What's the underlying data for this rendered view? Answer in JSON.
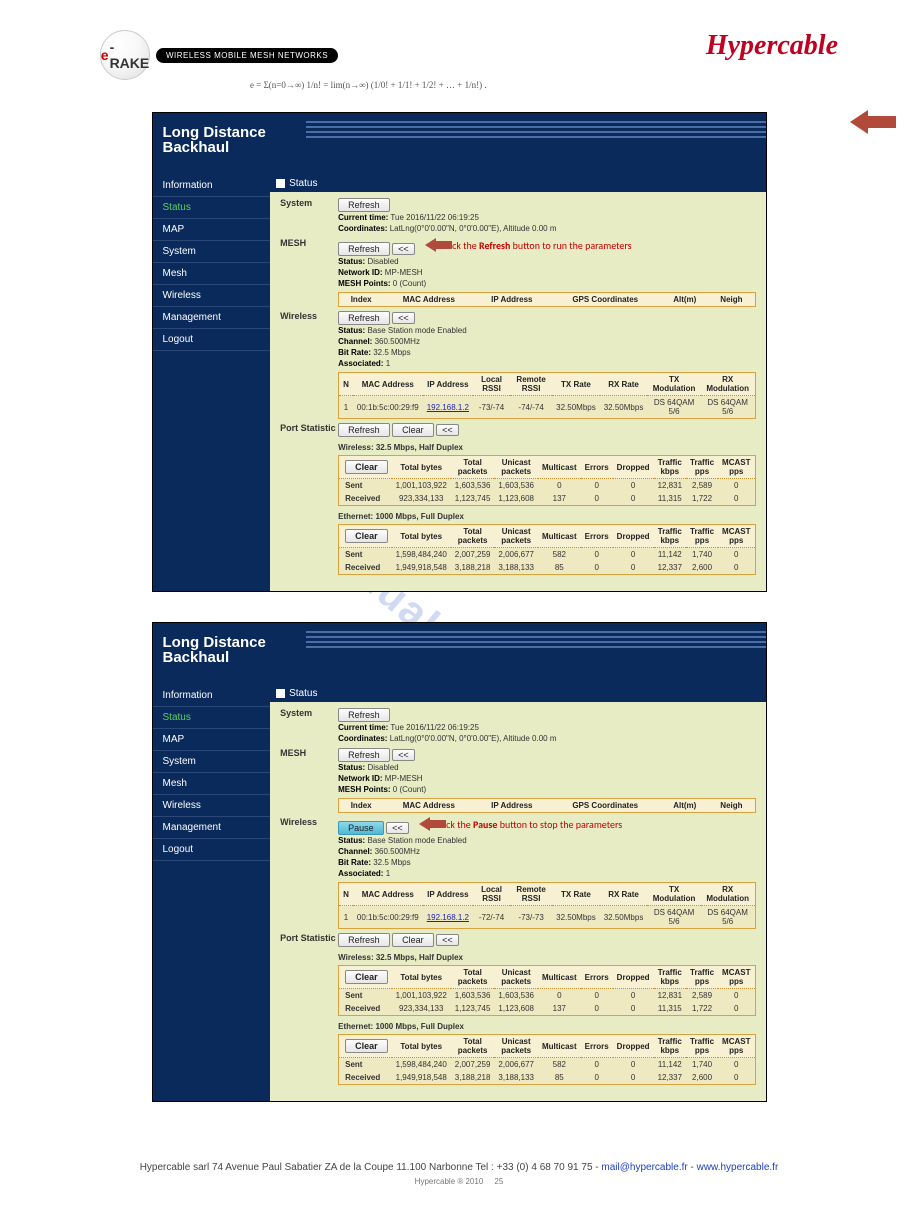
{
  "logos": {
    "erake_e": "e",
    "erake_text": "-RAKE",
    "erake_pill": "WIRELESS MOBILE MESH NETWORKS",
    "formula": "e = Σ(n=0→∞) 1/n! = lim(n→∞) (1/0! + 1/1! + 1/2! + … + 1/n!) .",
    "hypercable": "Hypercable"
  },
  "app_common": {
    "title_l1": "Long Distance",
    "title_l2": "Backhaul",
    "nav": [
      "Information",
      "Status",
      "MAP",
      "System",
      "Mesh",
      "Wireless",
      "Management",
      "Logout"
    ],
    "active_nav": "Status",
    "content_title": "Status",
    "buttons": {
      "refresh": "Refresh",
      "back": "<<",
      "clear": "Clear",
      "pause": "Pause"
    },
    "section_labels": {
      "system": "System",
      "mesh": "MESH",
      "wireless": "Wireless",
      "port": "Port Statistic"
    },
    "system_kv": {
      "current_time_label": "Current time:",
      "current_time": "Tue 2016/11/22 06:19:25",
      "coords_label": "Coordinates:",
      "coords": "LatLng(0°0'0.00\"N, 0°0'0.00\"E), Altitude 0.00 m"
    },
    "mesh_kv": {
      "status_label": "Status:",
      "status": "Disabled",
      "netid_label": "Network ID:",
      "netid": "MP-MESH",
      "points_label": "MESH Points:",
      "points": "0 (Count)"
    },
    "mesh_headers": [
      "Index",
      "MAC Address",
      "IP Address",
      "GPS Coordinates",
      "Alt(m)",
      "Neigh"
    ],
    "wireless_kv": {
      "status_label": "Status:",
      "status": "Base Station mode Enabled",
      "channel_label": "Channel:",
      "channel": "360.500MHz",
      "bitrate_label": "Bit Rate:",
      "bitrate": "32.5 Mbps",
      "assoc_label": "Associated:",
      "assoc": "1"
    },
    "wireless_headers": [
      "N",
      "MAC Address",
      "IP Address",
      "Local RSSI",
      "Remote RSSI",
      "TX Rate",
      "RX Rate",
      "TX Modulation",
      "RX Modulation"
    ],
    "port_headers": [
      "",
      "Total bytes",
      "Total packets",
      "Unicast packets",
      "Multicast",
      "Errors",
      "Dropped",
      "Traffic kbps",
      "Traffic pps",
      "MCAST pps"
    ],
    "port_row_labels": {
      "sent": "Sent",
      "received": "Received"
    },
    "port_subheadings": {
      "wireless": "Wireless: 32.5 Mbps, Half Duplex",
      "ethernet": "Ethernet: 1000 Mbps, Full Duplex"
    }
  },
  "app1": {
    "annot": {
      "prefix": "Click the ",
      "bold": "Refresh",
      "suffix": " button to run the parameters"
    },
    "wireless_row": {
      "n": "1",
      "mac": "00:1b:5c:00:29:f9",
      "ip": "192.168.1.2",
      "lrssi": "-73/-74",
      "rrssi": "-74/-74",
      "tx": "32.50Mbps",
      "rx": "32.50Mbps",
      "txmod": "DS 64QAM 5/6",
      "rxmod": "DS 64QAM 5/6"
    },
    "port_wireless": {
      "sent": {
        "bytes": "1,001,103,922",
        "tp": "1,603,536",
        "up": "1,603,536",
        "mc": "0",
        "err": "0",
        "drop": "0",
        "kbps": "12,831",
        "pps": "2,589",
        "mcast": "0"
      },
      "received": {
        "bytes": "923,334,133",
        "tp": "1,123,745",
        "up": "1,123,608",
        "mc": "137",
        "err": "0",
        "drop": "0",
        "kbps": "11,315",
        "pps": "1,722",
        "mcast": "0"
      }
    },
    "port_ethernet": {
      "sent": {
        "bytes": "1,598,484,240",
        "tp": "2,007,259",
        "up": "2,006,677",
        "mc": "582",
        "err": "0",
        "drop": "0",
        "kbps": "11,142",
        "pps": "1,740",
        "mcast": "0"
      },
      "received": {
        "bytes": "1,949,918,548",
        "tp": "3,188,218",
        "up": "3,188,133",
        "mc": "85",
        "err": "0",
        "drop": "0",
        "kbps": "12,337",
        "pps": "2,600",
        "mcast": "0"
      }
    }
  },
  "app2": {
    "annot": {
      "prefix": "Click the ",
      "bold": "Pause",
      "suffix": " button to stop the parameters"
    },
    "wireless_row": {
      "n": "1",
      "mac": "00:1b:5c:00:29:f9",
      "ip": "192.168.1.2",
      "lrssi": "-72/-74",
      "rrssi": "-73/-73",
      "tx": "32.50Mbps",
      "rx": "32.50Mbps",
      "txmod": "DS 64QAM 5/6",
      "rxmod": "DS 64QAM 5/6"
    },
    "port_wireless": {
      "sent": {
        "bytes": "1,001,103,922",
        "tp": "1,603,536",
        "up": "1,603,536",
        "mc": "0",
        "err": "0",
        "drop": "0",
        "kbps": "12,831",
        "pps": "2,589",
        "mcast": "0"
      },
      "received": {
        "bytes": "923,334,133",
        "tp": "1,123,745",
        "up": "1,123,608",
        "mc": "137",
        "err": "0",
        "drop": "0",
        "kbps": "11,315",
        "pps": "1,722",
        "mcast": "0"
      }
    },
    "port_ethernet": {
      "sent": {
        "bytes": "1,598,484,240",
        "tp": "2,007,259",
        "up": "2,006,677",
        "mc": "582",
        "err": "0",
        "drop": "0",
        "kbps": "11,142",
        "pps": "1,740",
        "mcast": "0"
      },
      "received": {
        "bytes": "1,949,918,548",
        "tp": "3,188,218",
        "up": "3,188,133",
        "mc": "85",
        "err": "0",
        "drop": "0",
        "kbps": "12,337",
        "pps": "2,600",
        "mcast": "0"
      }
    }
  },
  "watermark": "manualshive.com",
  "footer": {
    "line1_pre": "Hypercable ",
    "line1_addr": "sarl 74 Avenue Paul Sabatier ZA de la Coupe 11.100 Narbonne Tel : +33 (0) 4 68 70 91 75 - ",
    "email": "mail@hypercable.fr",
    "dash": " - ",
    "site": "www.hypercable.fr",
    "line2": "Hypercable ® 2010",
    "page": "25"
  }
}
